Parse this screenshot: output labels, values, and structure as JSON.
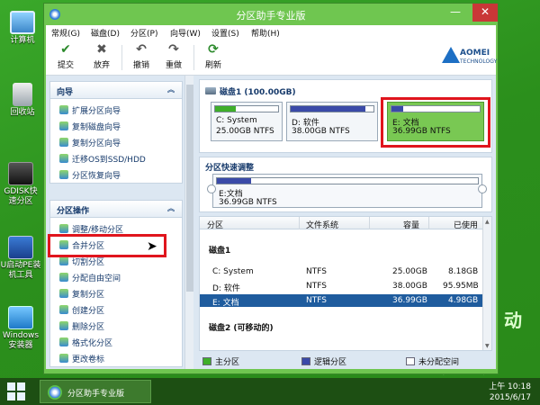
{
  "desktop": {
    "icons": [
      {
        "label": "计算机"
      },
      {
        "label": "回收站"
      },
      {
        "label": "GDISK快速分区"
      },
      {
        "label": "U启动PE装机工具"
      },
      {
        "label": "Windows安装器"
      }
    ],
    "brand_text": "启动",
    "brand_side_text": "动"
  },
  "window": {
    "title": "分区助手专业版",
    "controls": {
      "minimize": "—",
      "maximize": "□",
      "close": "✕"
    }
  },
  "menu": [
    "常规(G)",
    "磁盘(D)",
    "分区(P)",
    "向导(W)",
    "设置(S)",
    "帮助(H)"
  ],
  "toolbar": {
    "buttons": [
      {
        "label": "提交",
        "icon": "check-icon"
      },
      {
        "label": "放弃",
        "icon": "discard-icon"
      },
      {
        "label": "撤销",
        "icon": "undo-icon"
      },
      {
        "label": "重做",
        "icon": "redo-icon"
      },
      {
        "label": "刷新",
        "icon": "refresh-icon"
      }
    ],
    "brand_name": "AOMEI",
    "brand_sub": "TECHNOLOGY"
  },
  "wizard": {
    "title": "向导",
    "items": [
      "扩展分区向导",
      "复制磁盘向导",
      "复制分区向导",
      "迁移OS到SSD/HDD",
      "分区恢复向导"
    ]
  },
  "operations": {
    "title": "分区操作",
    "items": [
      "调整/移动分区",
      "合并分区",
      "切割分区",
      "分配自由空间",
      "复制分区",
      "创建分区",
      "删除分区",
      "格式化分区",
      "更改卷标"
    ]
  },
  "disk1": {
    "title": "磁盘1 (100.00GB)",
    "partitions": [
      {
        "name": "C: System",
        "size": "25.00GB NTFS",
        "used_fraction": 0.33,
        "color": "#3fae2a"
      },
      {
        "name": "D: 软件",
        "size": "38.00GB NTFS",
        "used_fraction": 0.9,
        "color": "#3a4aa8"
      },
      {
        "name": "E: 文档",
        "size": "36.99GB NTFS",
        "used_fraction": 0.13,
        "color": "#3a4aa8",
        "selected": true
      }
    ]
  },
  "quick_adjust": {
    "title": "分区快速调整",
    "name": "E:文档",
    "size": "36.99GB NTFS",
    "used_fraction": 0.13
  },
  "table": {
    "headers": [
      "分区",
      "文件系统",
      "容量",
      "已使用"
    ],
    "disk1_label": "磁盘1",
    "rows": [
      {
        "partition": "C: System",
        "fs": "NTFS",
        "capacity": "25.00GB",
        "used": "8.18GB"
      },
      {
        "partition": "D: 软件",
        "fs": "NTFS",
        "capacity": "38.00GB",
        "used": "95.95MB"
      },
      {
        "partition": "E: 文档",
        "fs": "NTFS",
        "capacity": "36.99GB",
        "used": "4.98GB"
      }
    ],
    "disk2_label": "磁盘2 (可移动的)"
  },
  "legend": [
    {
      "label": "主分区",
      "color": "#3fae2a"
    },
    {
      "label": "逻辑分区",
      "color": "#3a4aa8"
    },
    {
      "label": "未分配空间",
      "color": "#ffffff"
    }
  ],
  "taskbar": {
    "app_label": "分区助手专业版",
    "time": "上午 10:18",
    "date": "2015/6/17"
  }
}
